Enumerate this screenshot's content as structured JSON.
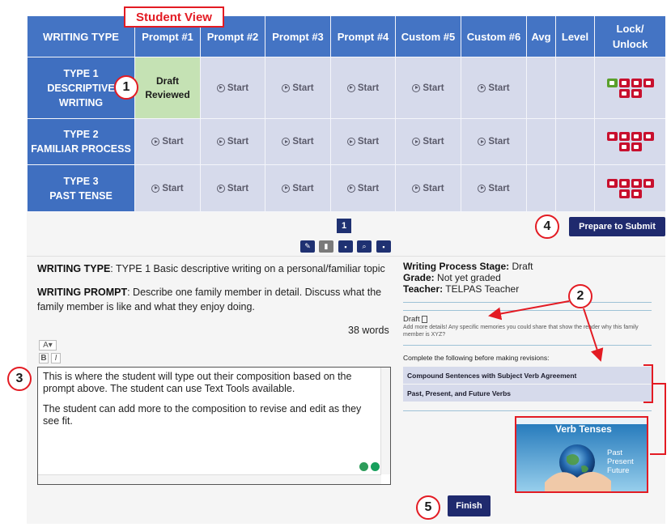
{
  "annotations": {
    "student_view_label": "Student View",
    "callouts": [
      "1",
      "2",
      "3",
      "4",
      "5"
    ]
  },
  "grid": {
    "headers": [
      "WRITING TYPE",
      "Prompt #1",
      "Prompt #2",
      "Prompt #3",
      "Prompt #4",
      "Custom #5",
      "Custom #6",
      "Avg",
      "Level",
      "Lock/ Unlock"
    ],
    "rows": [
      {
        "label_line1": "TYPE 1",
        "label_line2": "DESCRIPTIVE",
        "label_line3": "WRITING",
        "first_cell_line1": "Draft",
        "first_cell_line2": "Reviewed",
        "start_label": "Start"
      },
      {
        "label_line1": "TYPE 2",
        "label_line2": "FAMILIAR PROCESS",
        "label_line3": "",
        "start_label": "Start"
      },
      {
        "label_line1": "TYPE 3",
        "label_line2": "PAST TENSE",
        "label_line3": "",
        "start_label": "Start"
      }
    ]
  },
  "pagination": {
    "current_page": "1"
  },
  "buttons": {
    "prepare_to_submit": "Prepare to Submit",
    "finish": "Finish"
  },
  "left_panel": {
    "writing_type_label": "WRITING TYPE",
    "writing_type_value": ": TYPE 1 Basic descriptive writing on a personal/familiar topic",
    "writing_prompt_label": "WRITING PROMPT",
    "writing_prompt_value": ": Describe one family member in detail. Discuss what the family member is like and what they enjoy doing.",
    "word_count": "38 words",
    "font_size_control": "A▾",
    "bold_label": "B",
    "italic_label": "I",
    "editor_text_p1": "This is where the student will type out their composition based on the prompt above. The student can use Text Tools available.",
    "editor_text_p2": "The student can add more to the composition to revise and edit as they see fit."
  },
  "right_panel": {
    "stage_label": "Writing Process Stage:",
    "stage_value": "Draft",
    "grade_label": "Grade:",
    "grade_value": "Not yet graded",
    "teacher_label": "Teacher:",
    "teacher_value": "TELPAS Teacher",
    "feedback_title": "Draft",
    "feedback_text": "Add more details! Any specific memories you could share that show the reader why this family member is XYZ?",
    "revisions_heading": "Complete the following before making revisions:",
    "revision_items": [
      "Compound Sentences with Subject Verb Agreement",
      "Past, Present, and Future Verbs"
    ],
    "thumbnail": {
      "title": "Verb Tenses",
      "words": [
        "Past",
        "Present",
        "Future"
      ]
    }
  },
  "colors": {
    "header_blue": "#4474c4",
    "row_label_blue": "#3f6fc0",
    "cell_lavender": "#d6daeb",
    "reviewed_green": "#c5e2b4",
    "navy_button": "#1f2a6e",
    "annotation_red": "#e31b23",
    "lock_red": "#c8102e",
    "unlock_green": "#5aa02c"
  }
}
